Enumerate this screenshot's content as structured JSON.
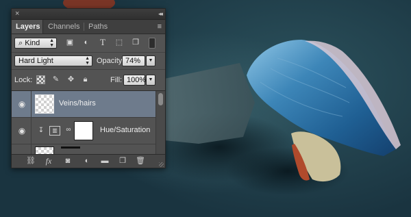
{
  "panel": {
    "close_glyph": "×",
    "collapse_glyph": "◂◂",
    "tabs": [
      {
        "label": "Layers",
        "active": true
      },
      {
        "label": "Channels",
        "active": false
      },
      {
        "label": "Paths",
        "active": false
      }
    ],
    "menu_glyph": "≡"
  },
  "filter": {
    "kind_label": "Kind",
    "icons": [
      "search-icon",
      "image-filter-icon",
      "adjustment-filter-icon",
      "type-filter-icon",
      "shape-filter-icon",
      "smart-object-filter-icon",
      "filter-toggle-icon"
    ]
  },
  "blend": {
    "mode": "Hard Light",
    "opacity_label": "Opacity:",
    "opacity_value": "74%"
  },
  "lock": {
    "label": "Lock:",
    "icons": [
      "lock-transparent-icon",
      "lock-paint-icon",
      "lock-position-icon",
      "lock-all-icon"
    ],
    "fill_label": "Fill:",
    "fill_value": "100%"
  },
  "layers": [
    {
      "name": "Veins/hairs",
      "selected": true,
      "visible": true,
      "thumb": "transparent"
    },
    {
      "name": "Hue/Saturation",
      "selected": false,
      "visible": true,
      "thumb": "mask-white",
      "clipped": true
    }
  ],
  "bottom_icons": [
    "link-layers-icon",
    "fx-icon",
    "add-mask-icon",
    "adjustment-layer-icon",
    "new-group-icon",
    "new-layer-icon",
    "trash-icon"
  ],
  "colors": {
    "selection": "#6e7b8c",
    "panel_bg": "#535353",
    "canvas_bg": "#1e3942"
  }
}
